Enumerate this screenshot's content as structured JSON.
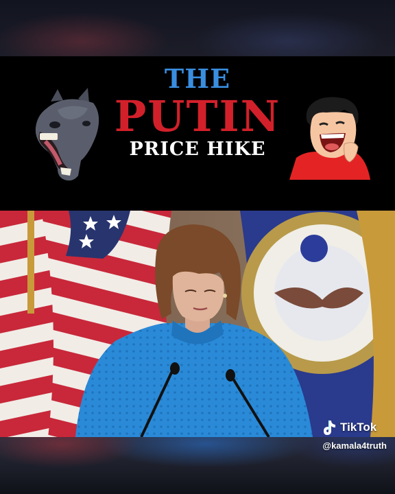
{
  "title": {
    "line1": "THE",
    "line2": "PUTIN",
    "line3": "PRICE HIKE"
  },
  "icons": {
    "left": "laughing-horse-icon",
    "right": "laughing-face-icon",
    "logo": "tiktok-icon"
  },
  "watermark": {
    "brand": "TikTok",
    "handle": "@kamala4truth"
  },
  "colors": {
    "the": "#3a8ee0",
    "putin": "#d2202a",
    "hike": "#ffffff",
    "band": "#000000"
  }
}
